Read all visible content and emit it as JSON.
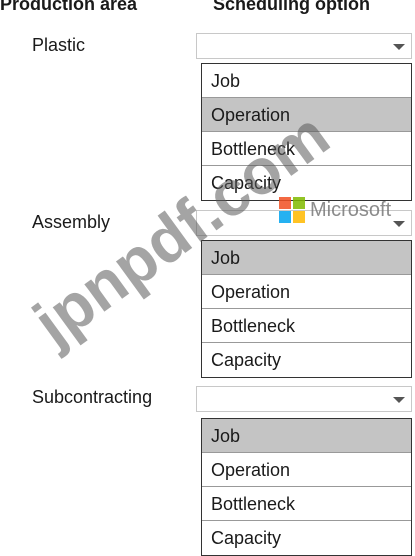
{
  "headers": {
    "area": "Production area",
    "option": "Scheduling option"
  },
  "rows": [
    {
      "label": "Plastic",
      "value": "",
      "options": [
        "Job",
        "Operation",
        "Bottleneck",
        "Capacity"
      ],
      "highlighted": "Operation"
    },
    {
      "label": "Assembly",
      "value": "",
      "options": [
        "Job",
        "Operation",
        "Bottleneck",
        "Capacity"
      ],
      "highlighted": "Job"
    },
    {
      "label": "Subcontracting",
      "value": "",
      "options": [
        "Job",
        "Operation",
        "Bottleneck",
        "Capacity"
      ],
      "highlighted": "Job"
    }
  ],
  "watermark": {
    "text": "jpnpdf.com",
    "logo_text": "Microsoft",
    "logo_colors": [
      "#f25022",
      "#7fba00",
      "#00a4ef",
      "#ffb900"
    ]
  },
  "colors": {
    "highlight": "#c4c4c4",
    "list_border": "#333333",
    "dropdown_border": "#c8c8c8"
  }
}
